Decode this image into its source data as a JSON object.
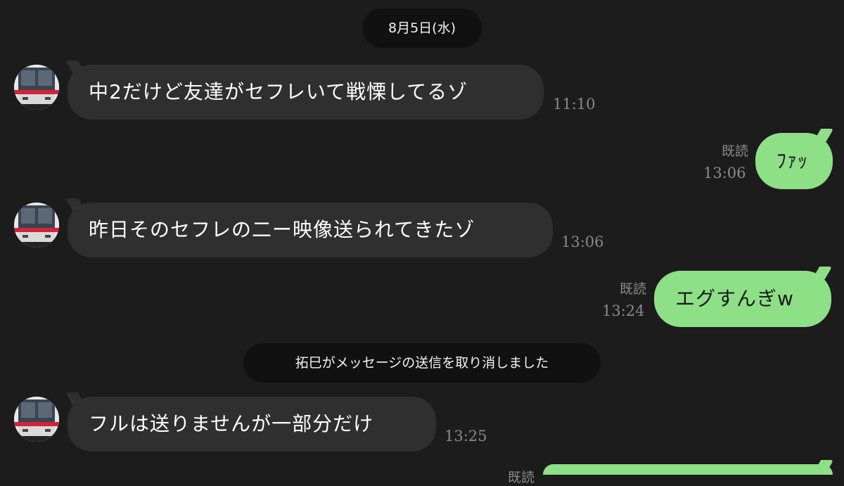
{
  "date_separator": "8月5日(水)",
  "system_notice": "拓巳がメッセージの送信を取り消しました",
  "messages": [
    {
      "direction": "incoming",
      "text": "中2だけど友達がセフレいて戦慄してるゾ",
      "time": "11:10"
    },
    {
      "direction": "outgoing",
      "text": "ﾌｧｯ",
      "time": "13:06",
      "read": "既読"
    },
    {
      "direction": "incoming",
      "text": "昨日そのセフレの二ー映像送られてきたゾ",
      "time": "13:06"
    },
    {
      "direction": "outgoing",
      "text": "エグすんぎw",
      "time": "13:24",
      "read": "既読"
    },
    {
      "direction": "incoming",
      "text": "フルは送りませんが一部分だけ",
      "time": "13:25"
    },
    {
      "direction": "outgoing",
      "text": "",
      "time": "",
      "read": "既読"
    }
  ],
  "colors": {
    "background": "#1c1c1c",
    "incoming_bubble": "#2f2f2f",
    "outgoing_bubble": "#8ee086",
    "pill": "#111111",
    "meta_text": "#8a8a8a"
  },
  "icons": {
    "avatar": "train-avatar-icon"
  }
}
